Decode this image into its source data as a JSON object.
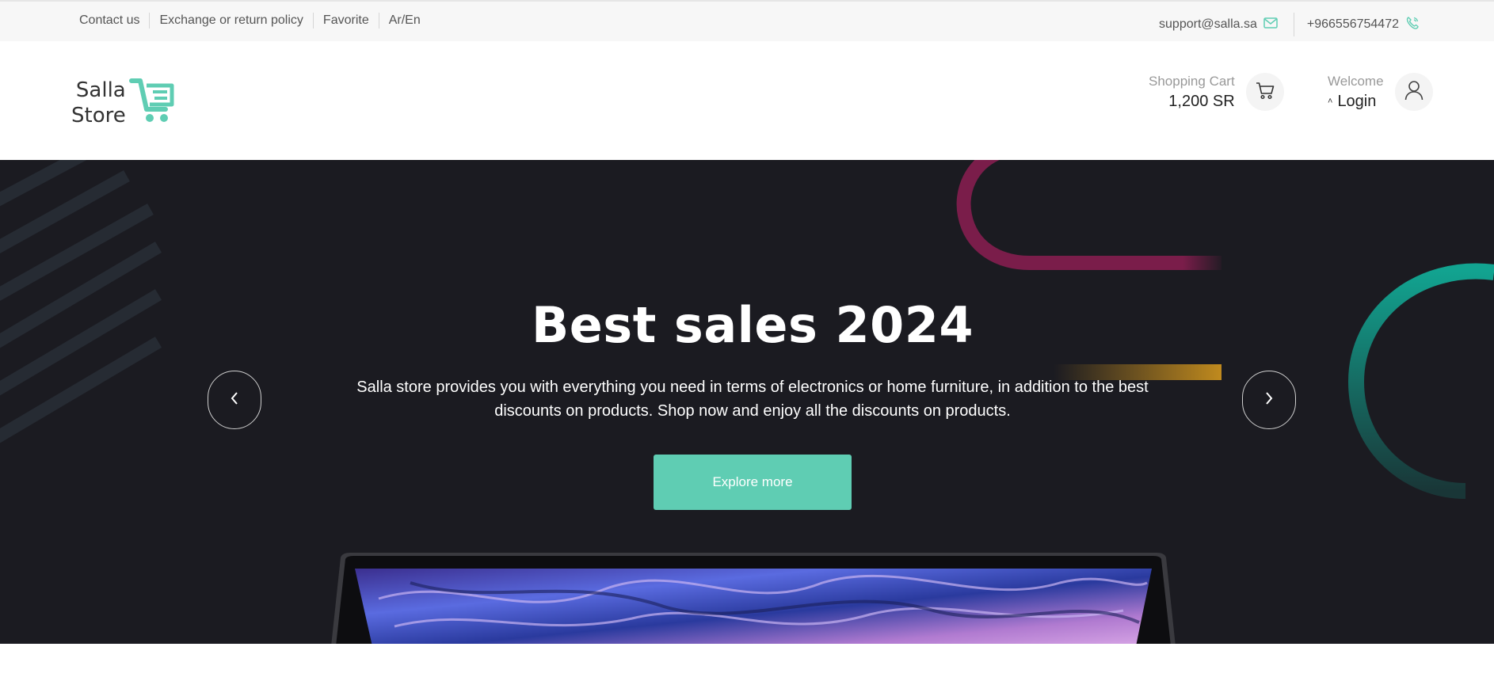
{
  "topbar": {
    "links": [
      "Contact us",
      "Exchange or return policy",
      "Favorite",
      "Ar/En"
    ],
    "email": "support@salla.sa",
    "phone": "+966556754472",
    "email_icon": "mail-icon",
    "phone_icon": "phone-icon"
  },
  "header": {
    "logo": {
      "line1": "Salla",
      "line2": "Store",
      "icon": "cart-logo-icon"
    },
    "cart": {
      "label": "Shopping Cart",
      "value": "1,200 SR",
      "icon": "shopping-cart-icon"
    },
    "user": {
      "label": "Welcome",
      "value": "Login",
      "icon": "user-icon"
    }
  },
  "hero": {
    "title": "Best sales 2024",
    "description": "Salla store provides you with everything you need in terms of electronics or home furniture, in addition to the best discounts on products. Shop now and enjoy all the discounts on products.",
    "button": "Explore more",
    "prev_icon": "chevron-left-icon",
    "next_icon": "chevron-right-icon"
  },
  "colors": {
    "accent": "#5fcdb3",
    "hero_bg": "#1b1b21",
    "magenta": "#7a1d4a",
    "gold": "#c08a1e",
    "teal": "#12a390"
  }
}
